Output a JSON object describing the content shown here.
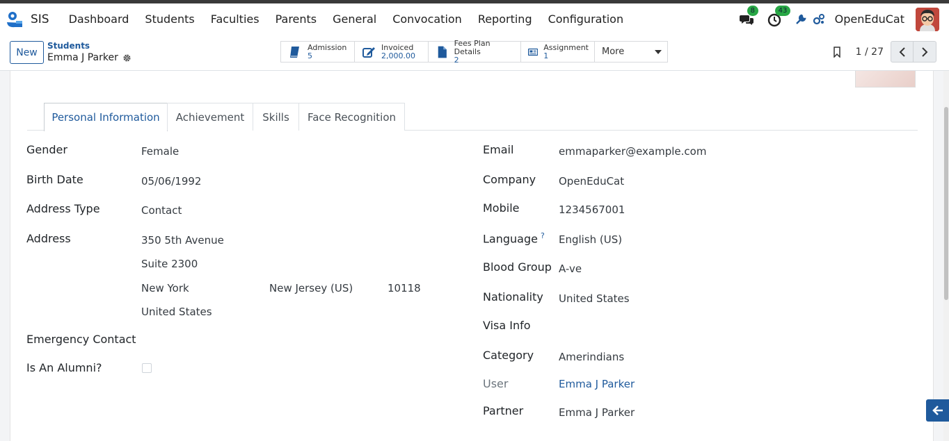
{
  "app": {
    "name": "SIS",
    "logo_icon": "openeducat-logo-icon"
  },
  "menu": [
    "Dashboard",
    "Students",
    "Faculties",
    "Parents",
    "General",
    "Convocation",
    "Reporting",
    "Configuration"
  ],
  "systray": {
    "messages_count": "8",
    "activities_count": "43",
    "company": "OpenEduCat"
  },
  "control": {
    "new_label": "New",
    "breadcrumb_parent": "Students",
    "record_name": "Emma J Parker",
    "pager_value": "1 / 27"
  },
  "smart_buttons": [
    {
      "label": "Admission",
      "value": "5",
      "icon": "book-icon"
    },
    {
      "label": "Invoiced",
      "value": "2,000.00",
      "icon": "pencil-square-icon"
    },
    {
      "label": "Fees Plan Details",
      "value": "2",
      "icon": "file-icon"
    },
    {
      "label": "Assignment",
      "value": "1",
      "icon": "newspaper-icon"
    }
  ],
  "more_label": "More",
  "tabs": [
    "Personal Information",
    "Achievement",
    "Skills",
    "Face Recognition"
  ],
  "active_tab": "Personal Information",
  "left_fields": {
    "gender": {
      "label": "Gender",
      "value": "Female"
    },
    "birth_date": {
      "label": "Birth Date",
      "value": "05/06/1992"
    },
    "address_type": {
      "label": "Address Type",
      "value": "Contact"
    },
    "address": {
      "label": "Address",
      "street": "350 5th Avenue",
      "street2": "Suite 2300",
      "city": "New York",
      "state": "New Jersey (US)",
      "zip": "10118",
      "country": "United States"
    },
    "emergency_contact": {
      "label": "Emergency Contact",
      "value": ""
    },
    "is_alumni": {
      "label": "Is An Alumni?",
      "checked": false
    }
  },
  "right_fields": {
    "email": {
      "label": "Email",
      "value": "emmaparker@example.com"
    },
    "company": {
      "label": "Company",
      "value": "OpenEduCat"
    },
    "mobile": {
      "label": "Mobile",
      "value": "1234567001"
    },
    "language": {
      "label": "Language",
      "help": "?",
      "value": "English (US)"
    },
    "blood_group": {
      "label": "Blood Group",
      "value": "A-ve"
    },
    "nationality": {
      "label": "Nationality",
      "value": "United States"
    },
    "visa_info": {
      "label": "Visa Info",
      "value": ""
    },
    "category": {
      "label": "Category",
      "value": "Amerindians"
    },
    "user": {
      "label": "User",
      "value": "Emma J Parker"
    },
    "partner": {
      "label": "Partner",
      "value": "Emma J Parker"
    }
  },
  "colors": {
    "primary": "#1f5a9c",
    "badge_green": "#28a745",
    "topstrip": "#3a3a3a"
  }
}
